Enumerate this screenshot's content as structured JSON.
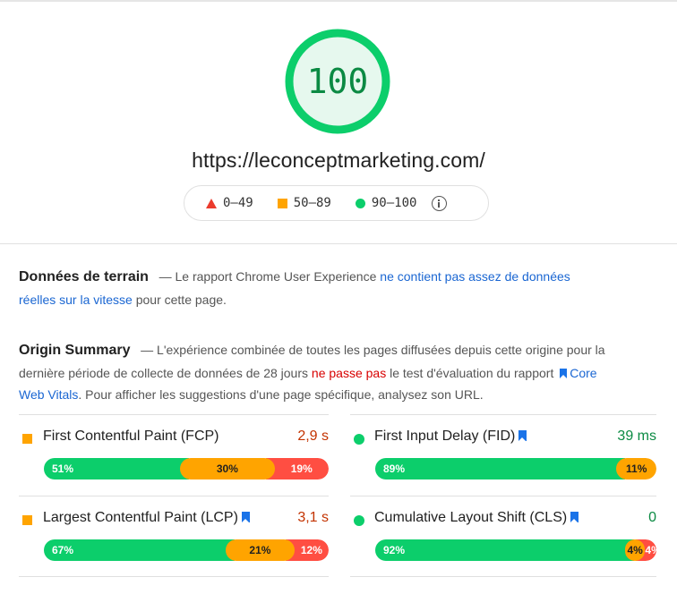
{
  "score": {
    "value": "100",
    "color": "#0cce6b"
  },
  "url": "https://leconceptmarketing.com/",
  "legend": {
    "items": [
      {
        "icon": "triangle-icon",
        "label": "0–49",
        "color": "#eb3b2d"
      },
      {
        "icon": "square-icon",
        "label": "50–89",
        "color": "#ffa400"
      },
      {
        "icon": "circle-icon",
        "label": "90–100",
        "color": "#0cce6b"
      }
    ]
  },
  "field_data": {
    "title": "Données de terrain",
    "dash": "—",
    "text_before": "Le rapport Chrome User Experience ",
    "link": "ne contient pas assez de données réelles sur la vitesse",
    "text_after": " pour cette page."
  },
  "origin_summary": {
    "title": "Origin Summary",
    "dash": "—",
    "text_before": "L'expérience combinée de toutes les pages diffusées depuis cette origine pour la dernière période de collecte de données de 28 jours ",
    "fail_text": "ne passe pas",
    "text_middle": " le test d'évaluation du rapport ",
    "link": "Core Web Vitals",
    "text_after": ". Pour afficher les suggestions d'une page spécifique, analysez son URL."
  },
  "metrics": [
    {
      "name": "First Contentful Paint (FCP)",
      "value": "2,9 s",
      "status": "average",
      "core_vital": false,
      "distribution": {
        "good": 51,
        "average": 30,
        "poor": 19
      },
      "labels": {
        "good": "51%",
        "average": "30%",
        "poor": "19%"
      }
    },
    {
      "name": "First Input Delay (FID)",
      "value": "39 ms",
      "status": "good",
      "core_vital": true,
      "distribution": {
        "good": 89,
        "average": 11,
        "poor": 0
      },
      "labels": {
        "good": "89%",
        "average": "11%",
        "poor": ""
      }
    },
    {
      "name": "Largest Contentful Paint (LCP)",
      "value": "3,1 s",
      "status": "average",
      "core_vital": true,
      "distribution": {
        "good": 67,
        "average": 21,
        "poor": 12
      },
      "labels": {
        "good": "67%",
        "average": "21%",
        "poor": "12%"
      }
    },
    {
      "name": "Cumulative Layout Shift (CLS)",
      "value": "0",
      "status": "good",
      "core_vital": true,
      "distribution": {
        "good": 92,
        "average": 4,
        "poor": 4
      },
      "labels": {
        "good": "92%",
        "average": "4%",
        "poor": "4%"
      }
    }
  ],
  "colors": {
    "good": "#0cce6b",
    "average": "#ffa400",
    "poor": "#ff4e42",
    "link": "#1a66d2",
    "fail": "#d80000"
  }
}
